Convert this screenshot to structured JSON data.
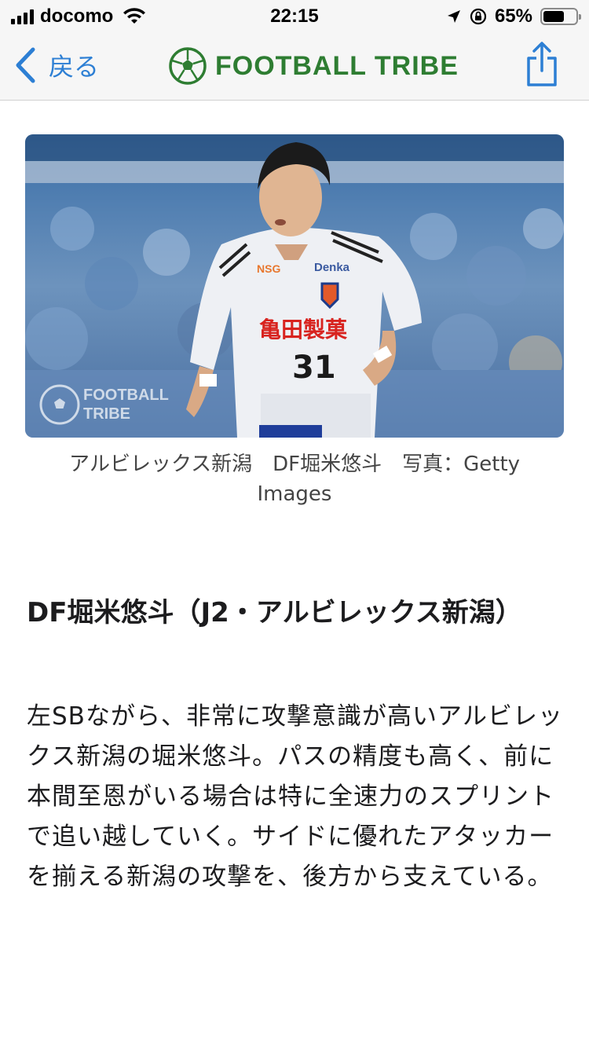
{
  "status_bar": {
    "carrier": "docomo",
    "time": "22:15",
    "battery_percent": "65%",
    "battery_level": 0.65
  },
  "nav": {
    "back_label": "戻る",
    "logo_text": "FOOTBALL TRIBE",
    "share_icon": "share-icon"
  },
  "hero": {
    "watermark_line1": "FOOTBALL",
    "watermark_line2": "TRIBE",
    "jersey_number": "31",
    "jersey_sponsor": "亀田製菓",
    "jersey_brand": "Denka",
    "jersey_nsg": "NSG"
  },
  "article": {
    "caption": "アルビレックス新潟　DF堀米悠斗　写真：Getty Images",
    "heading": "DF堀米悠斗（J2・アルビレックス新潟）",
    "body": "左SBながら、非常に攻撃意識が高いアルビレックス新潟の堀米悠斗。パスの精度も高く、前に本間至恩がいる場合は特に全速力のスプリントで追い越していく。サイドに優れたアタッカーを揃える新潟の攻撃を、後方から支えている。"
  },
  "colors": {
    "accent_blue": "#2d7fd4",
    "logo_green": "#2e7d32"
  }
}
